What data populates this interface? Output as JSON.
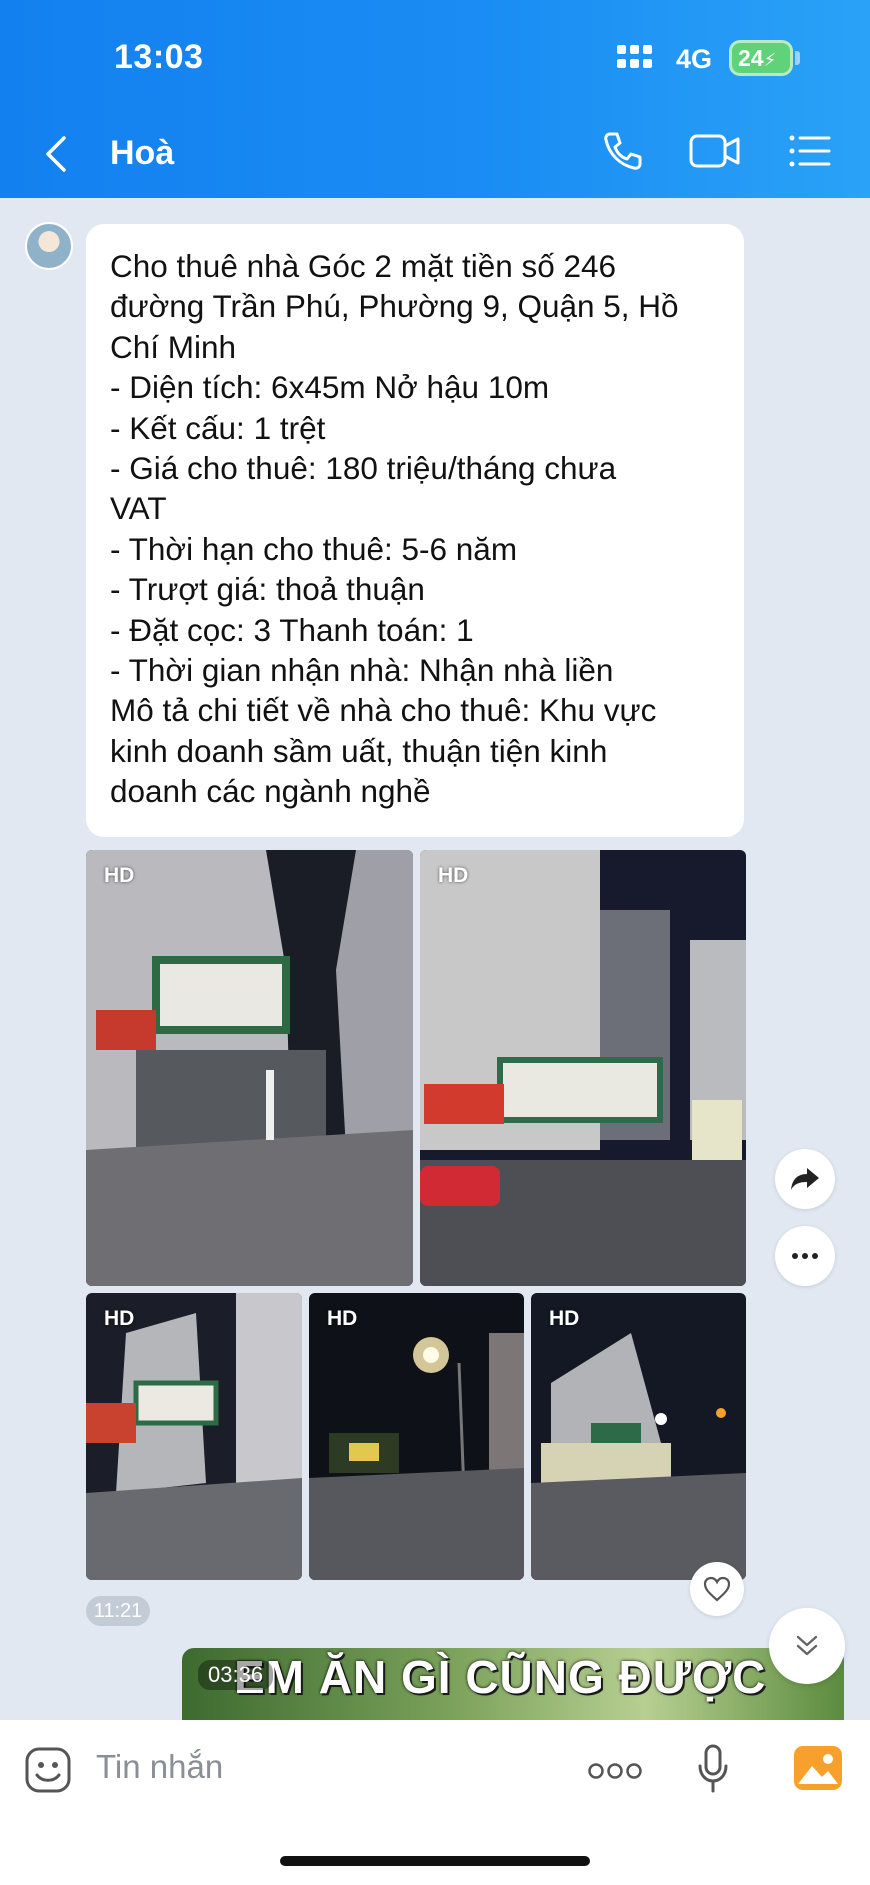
{
  "status_bar": {
    "time": "13:03",
    "network": "4G",
    "battery": "24"
  },
  "header": {
    "title": "Hoà",
    "back_icon": "chevron-left-icon",
    "actions": [
      "phone-icon",
      "video-call-icon",
      "menu-list-icon"
    ]
  },
  "message": {
    "text": "Cho thuê nhà Góc 2 mặt tiền số 246\nđường Trần Phú, Phường 9, Quận 5, Hồ\nChí Minh\n- Diện tích: 6x45m Nở hậu 10m\n- Kết cấu: 1 trệt\n- Giá cho thuê: 180 triệu/tháng chưa\nVAT\n- Thời hạn cho thuê: 5-6 năm\n- Trượt giá: thoả thuận\n- Đặt cọc: 3 Thanh toán: 1\n- Thời gian nhận nhà: Nhận nhà liền\nMô tả chi tiết về nhà cho thuê: Khu vực\nkinh doanh sầm uất, thuận tiện kinh\ndoanh các ngành nghề",
    "time": "11:21"
  },
  "photos": [
    {
      "badge": "HD",
      "scene": "corner-building-night"
    },
    {
      "badge": "HD",
      "scene": "tall-building-street-night"
    },
    {
      "badge": "HD",
      "scene": "building-side-night"
    },
    {
      "badge": "HD",
      "scene": "street-lamp-night"
    },
    {
      "badge": "HD",
      "scene": "street-corner-night"
    }
  ],
  "video": {
    "duration": "03:36",
    "caption": "EM ĂN GÌ CŨNG ĐƯỢC"
  },
  "input": {
    "placeholder": "Tin nhắn"
  },
  "colors": {
    "header": "#1a8cf3",
    "background": "#e2e8f1",
    "battery": "#5fd27a"
  }
}
